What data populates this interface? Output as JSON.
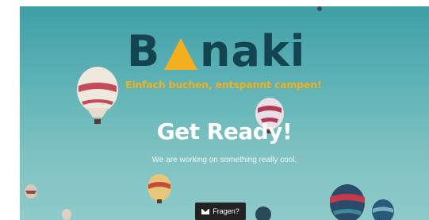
{
  "brand": {
    "logo_b": "B",
    "logo_rest": "naki",
    "tagline": "Einfach buchen, entspannt campen!",
    "colors": {
      "dark": "#13444f",
      "accent": "#f2b01e"
    }
  },
  "hero": {
    "heading": "Get Ready!",
    "subline": "We are working on something really cool."
  },
  "contact_button": {
    "label": "Fragen?",
    "icon": "envelope-icon"
  }
}
